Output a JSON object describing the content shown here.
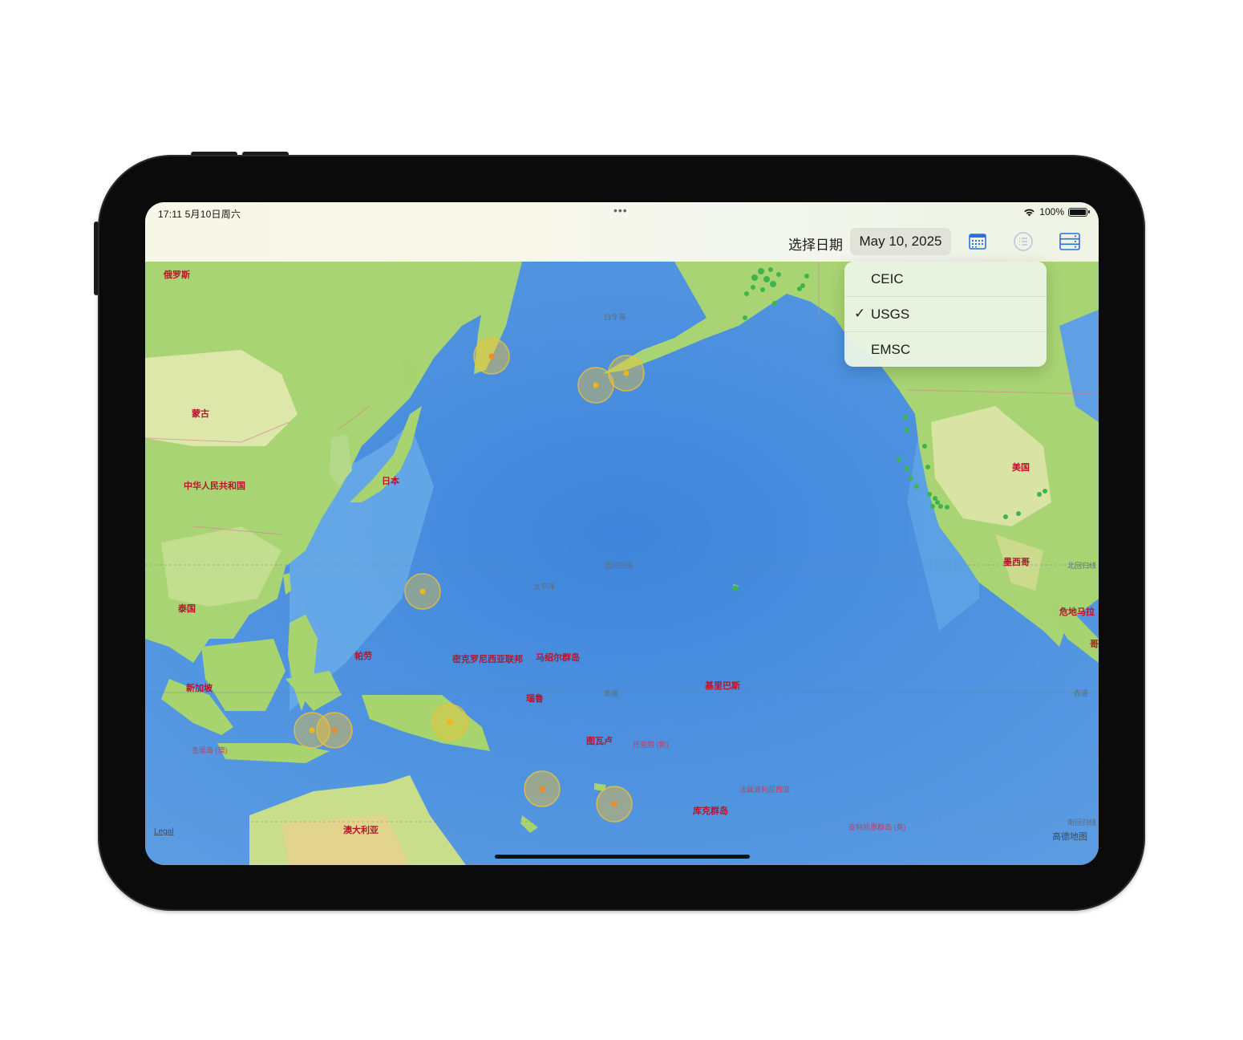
{
  "status_bar": {
    "time_date": "17:11   5月10日周六",
    "dots": "•••",
    "battery_pct": "100%"
  },
  "toolbar": {
    "date_label": "选择日期",
    "date_value": "May 10, 2025",
    "icons": [
      "calendar-icon",
      "list-icon",
      "server-icon"
    ]
  },
  "source_menu": {
    "items": [
      {
        "label": "CEIC",
        "checked": false
      },
      {
        "label": "USGS",
        "checked": true
      },
      {
        "label": "EMSC",
        "checked": false
      }
    ],
    "check_mark": "✓"
  },
  "map": {
    "labels": {
      "russia": "俄罗斯",
      "mongolia": "蒙古",
      "china": "中华人民共和国",
      "japan": "日本",
      "thailand": "泰国",
      "singapore": "新加坡",
      "palau": "帕劳",
      "micronesia": "密克罗尼西亚联邦",
      "marshall": "马绍尔群岛",
      "kiribati": "基里巴斯",
      "nauru": "瑙鲁",
      "tuvalu": "图瓦卢",
      "tokelau": "托克劳 (新)",
      "usa": "美国",
      "mexico": "墨西哥",
      "guatemala": "危地马拉",
      "australia": "澳大利亚",
      "cook": "库克群岛",
      "fr_polynesia": "法属波利尼西亚",
      "pitcairn": "皮特凯恩群岛 (英)",
      "christmas_island": "圣诞岛 (澳)",
      "bering_sea": "白令海",
      "pacific": "太平洋",
      "tropic_cancer": "北回归线",
      "tropic_cancer_right": "北回归线",
      "equator": "赤道",
      "equator_right": "赤道",
      "tropic_capricorn": "南回归线",
      "colombia_edge": "哥"
    },
    "legal": "Legal",
    "provider": "高德地图"
  },
  "colors": {
    "ocean": "#4a8fe0",
    "land": "#9bcf6b",
    "quake_yellow": "#f1c232",
    "quake_orange": "#f08a24",
    "quake_green": "#3cb54a",
    "label_red": "#b5162d"
  }
}
